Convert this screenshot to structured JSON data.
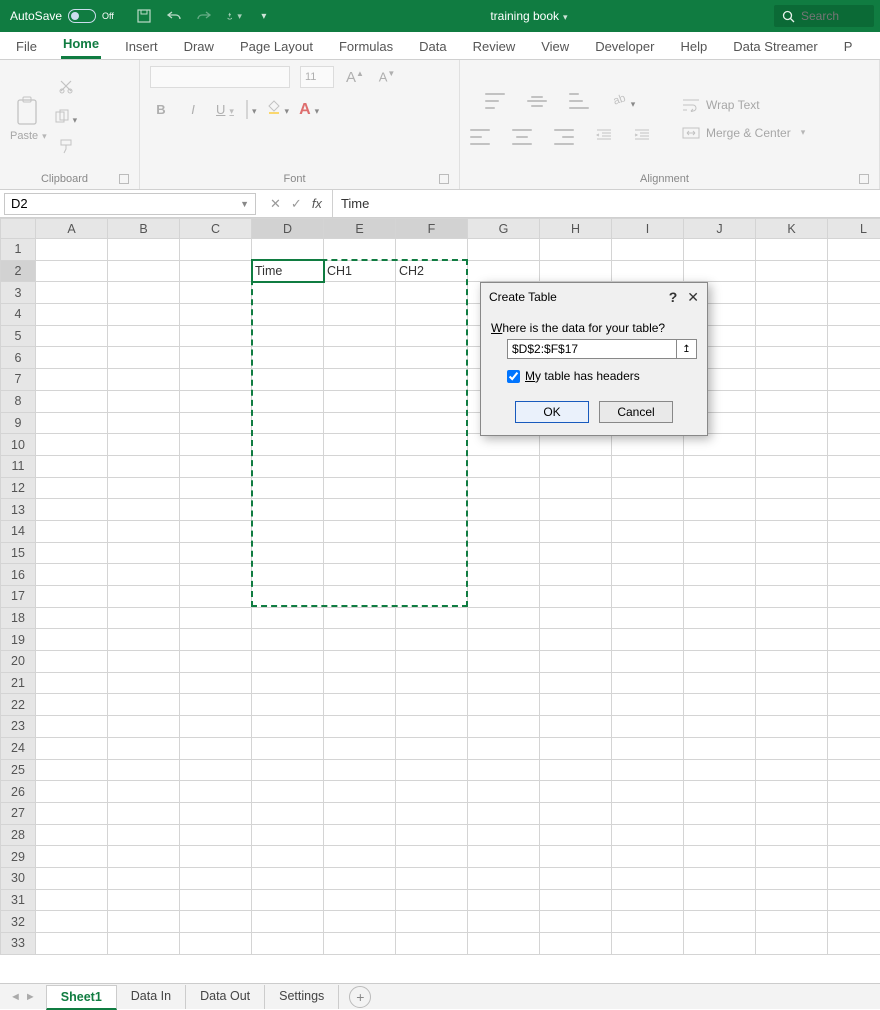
{
  "titlebar": {
    "autosave_label": "AutoSave",
    "autosave_state": "Off",
    "book_title": "training book",
    "search_placeholder": "Search"
  },
  "tabs": [
    "File",
    "Home",
    "Insert",
    "Draw",
    "Page Layout",
    "Formulas",
    "Data",
    "Review",
    "View",
    "Developer",
    "Help",
    "Data Streamer",
    "P"
  ],
  "active_tab": "Home",
  "ribbon": {
    "clipboard": {
      "label": "Clipboard",
      "paste": "Paste"
    },
    "font": {
      "label": "Font",
      "size": "11"
    },
    "alignment": {
      "label": "Alignment",
      "wrap": "Wrap Text",
      "merge": "Merge & Center"
    }
  },
  "namebox": "D2",
  "formula": "Time",
  "columns": [
    "A",
    "B",
    "C",
    "D",
    "E",
    "F",
    "G",
    "H",
    "I",
    "J",
    "K",
    "L"
  ],
  "rows": [
    "1",
    "2",
    "3",
    "4",
    "5",
    "6",
    "7",
    "8",
    "9",
    "10",
    "11",
    "12",
    "13",
    "14",
    "15",
    "16",
    "17",
    "18",
    "19",
    "20",
    "21",
    "22",
    "23",
    "24",
    "25",
    "26",
    "27",
    "28",
    "29",
    "30",
    "31",
    "32",
    "33"
  ],
  "cells": {
    "D2": "Time",
    "E2": "CH1",
    "F2": "CH2"
  },
  "active_cell": "D2",
  "selection_range": "D2:F17",
  "dialog": {
    "title": "Create Table",
    "prompt": "Where is the data for your table?",
    "range": "$D$2:$F$17",
    "headers_label": "My table has headers",
    "headers_checked": true,
    "ok": "OK",
    "cancel": "Cancel"
  },
  "sheet_tabs": [
    "Sheet1",
    "Data In",
    "Data Out",
    "Settings"
  ],
  "active_sheet": "Sheet1"
}
